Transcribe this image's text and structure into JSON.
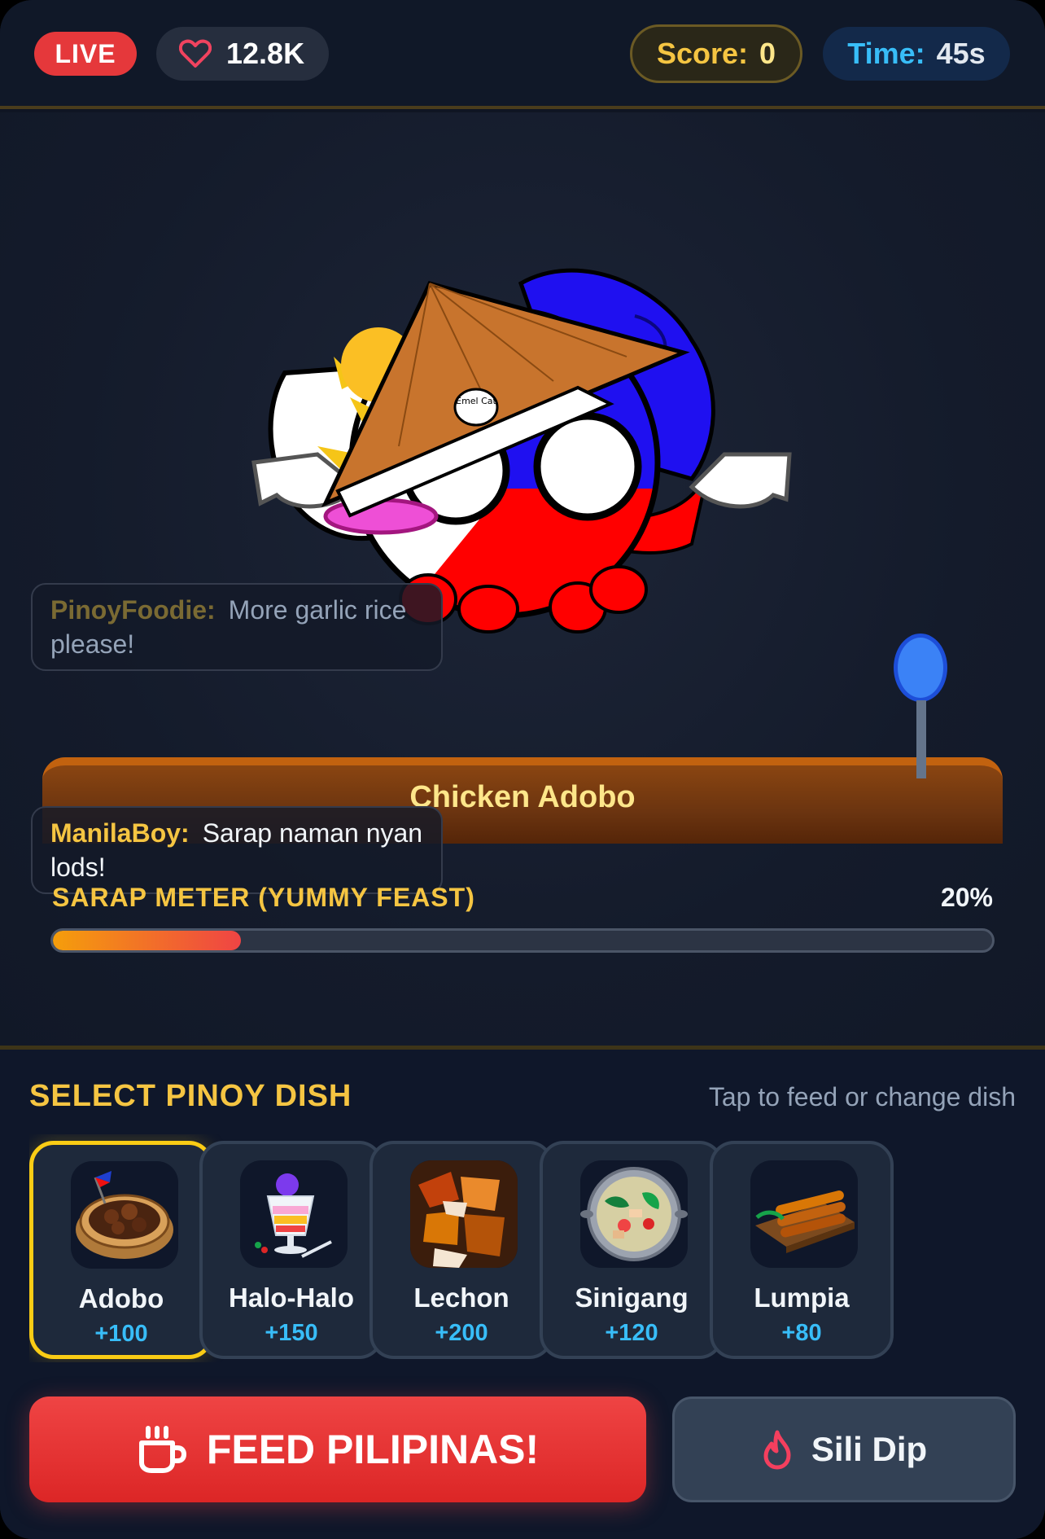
{
  "header": {
    "live_label": "LIVE",
    "likes": "12.8K",
    "score_label": "Score:",
    "score_value": "0",
    "time_label": "Time:",
    "time_value": "45s"
  },
  "stage": {
    "table_dish": "Chicken Adobo",
    "chat": [
      {
        "user": "PinoyFoodie:",
        "text": "More garlic rice please!"
      },
      {
        "user": "ManilaBoy:",
        "text": "Sarap naman nyan lods!"
      }
    ],
    "meter": {
      "label": "SARAP METER (YUMMY FEAST)",
      "percent_label": "20%",
      "fraction": 0.2
    },
    "hat_text": "Emel Cat"
  },
  "panel": {
    "title": "SELECT PINOY DISH",
    "hint": "Tap to feed or change dish",
    "dishes": [
      {
        "name": "Adobo",
        "points": "+100",
        "icon": "adobo-bowl-icon",
        "selected": true
      },
      {
        "name": "Halo-Halo",
        "points": "+150",
        "icon": "halo-halo-glass-icon",
        "selected": false
      },
      {
        "name": "Lechon",
        "points": "+200",
        "icon": "lechon-icon",
        "selected": false
      },
      {
        "name": "Sinigang",
        "points": "+120",
        "icon": "sinigang-pot-icon",
        "selected": false
      },
      {
        "name": "Lumpia",
        "points": "+80",
        "icon": "lumpia-board-icon",
        "selected": false
      }
    ]
  },
  "actions": {
    "feed_label": "FEED PILIPINAS!",
    "feed_icon": "coffee-cup-icon",
    "dip_label": "Sili Dip",
    "dip_icon": "flame-icon"
  },
  "colors": {
    "live": "#e5383b",
    "score": "#f5c542",
    "time": "#38bdf8",
    "feed_button": "#ef4444",
    "selected_border": "#facc15"
  }
}
